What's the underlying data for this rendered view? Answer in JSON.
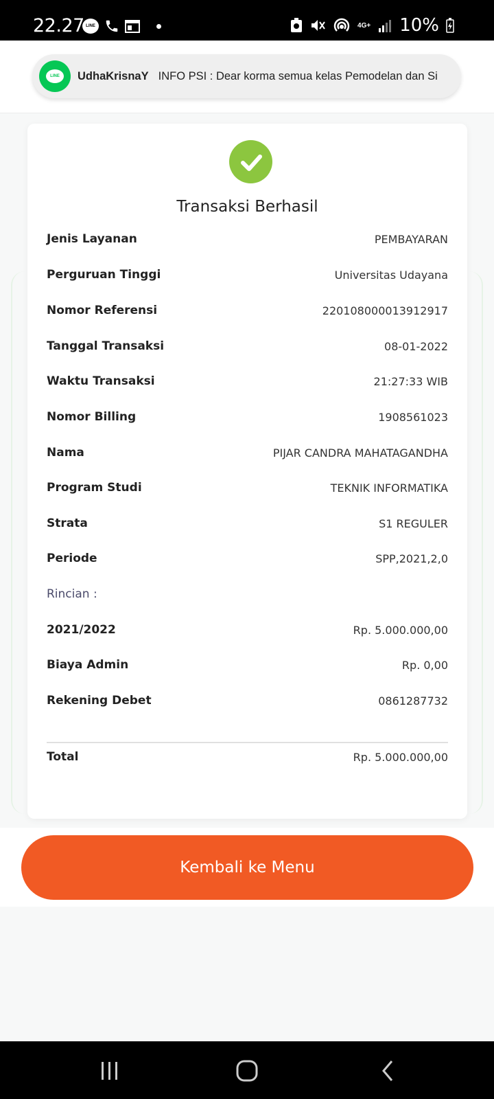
{
  "status_bar": {
    "time": "22.27",
    "battery": "10%",
    "network": "4G+"
  },
  "notification": {
    "app_icon": "line-icon",
    "app_icon_text": "LINE",
    "sender": "UdhaKrisnaY",
    "message": "INFO PSI : Dear korma semua kelas Pemodelan dan Si"
  },
  "receipt": {
    "title": "Transaksi Berhasil",
    "rows": [
      {
        "label": "Jenis Layanan",
        "value": "PEMBAYARAN"
      },
      {
        "label": "Perguruan Tinggi",
        "value": "Universitas Udayana"
      },
      {
        "label": "Nomor Referensi",
        "value": "220108000013912917"
      },
      {
        "label": "Tanggal Transaksi",
        "value": "08-01-2022"
      },
      {
        "label": "Waktu Transaksi",
        "value": "21:27:33 WIB"
      },
      {
        "label": "Nomor Billing",
        "value": "1908561023"
      },
      {
        "label": "Nama",
        "value": "PIJAR CANDRA MAHATAGANDHA"
      },
      {
        "label": "Program Studi",
        "value": "TEKNIK INFORMATIKA"
      },
      {
        "label": "Strata",
        "value": "S1 REGULER"
      },
      {
        "label": "Periode",
        "value": "SPP,2021,2,0"
      }
    ],
    "rincian_label": "Rincian :",
    "rincian_rows": [
      {
        "label": "2021/2022",
        "value": "Rp. 5.000.000,00"
      },
      {
        "label": "Biaya Admin",
        "value": "Rp. 0,00"
      },
      {
        "label": "Rekening Debet",
        "value": "0861287732"
      }
    ],
    "total_label": "Total",
    "total_value": "Rp. 5.000.000,00"
  },
  "button": {
    "label": "Kembali ke Menu"
  },
  "colors": {
    "success": "#8cc63f",
    "primary_button": "#f15a24",
    "line_brand": "#06c755"
  }
}
